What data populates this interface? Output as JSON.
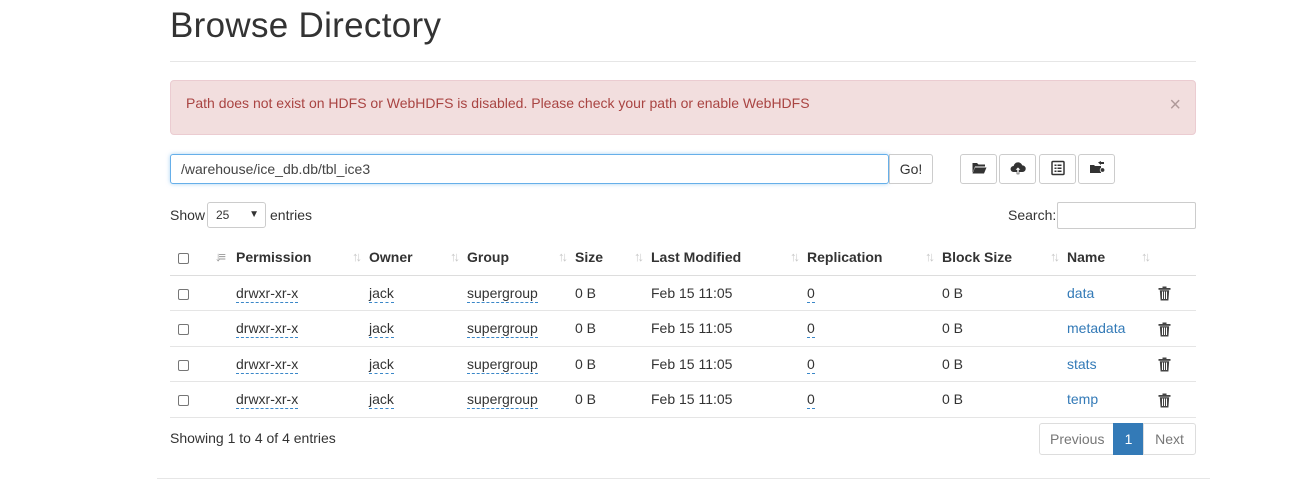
{
  "page": {
    "title": "Browse Directory"
  },
  "alert": {
    "message": "Path does not exist on HDFS or WebHDFS is disabled. Please check your path or enable WebHDFS",
    "close": "×"
  },
  "path": {
    "value": "/warehouse/ice_db.db/tbl_ice3",
    "go_label": "Go!"
  },
  "toolbar": {
    "buttons": [
      {
        "name": "create-directory",
        "icon": "folder-open-icon"
      },
      {
        "name": "upload-files",
        "icon": "cloud-upload-icon"
      },
      {
        "name": "cut-paste",
        "icon": "list-alt-icon"
      },
      {
        "name": "move-files",
        "icon": "folder-move-icon"
      }
    ]
  },
  "length": {
    "show_label": "Show",
    "selected": "25",
    "entries_label": "entries"
  },
  "search": {
    "label": "Search:",
    "value": ""
  },
  "table": {
    "headers": [
      "Permission",
      "Owner",
      "Group",
      "Size",
      "Last Modified",
      "Replication",
      "Block Size",
      "Name"
    ],
    "rows": [
      {
        "permission": "drwxr-xr-x",
        "owner": "jack",
        "group": "supergroup",
        "size": "0 B",
        "modified": "Feb 15 11:05",
        "replication": "0",
        "block_size": "0 B",
        "name": "data"
      },
      {
        "permission": "drwxr-xr-x",
        "owner": "jack",
        "group": "supergroup",
        "size": "0 B",
        "modified": "Feb 15 11:05",
        "replication": "0",
        "block_size": "0 B",
        "name": "metadata"
      },
      {
        "permission": "drwxr-xr-x",
        "owner": "jack",
        "group": "supergroup",
        "size": "0 B",
        "modified": "Feb 15 11:05",
        "replication": "0",
        "block_size": "0 B",
        "name": "stats"
      },
      {
        "permission": "drwxr-xr-x",
        "owner": "jack",
        "group": "supergroup",
        "size": "0 B",
        "modified": "Feb 15 11:05",
        "replication": "0",
        "block_size": "0 B",
        "name": "temp"
      }
    ]
  },
  "footer": {
    "info": "Showing 1 to 4 of 4 entries",
    "pagination": {
      "previous": "Previous",
      "current": "1",
      "next": "Next"
    }
  },
  "colors": {
    "accent": "#337ab7",
    "alert_bg": "#f2dede",
    "alert_text": "#a94442"
  }
}
